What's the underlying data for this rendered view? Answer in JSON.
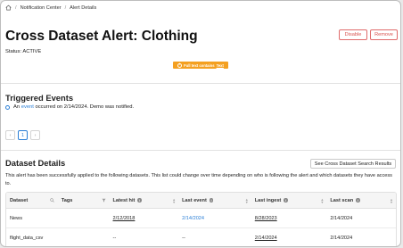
{
  "breadcrumb": {
    "items": [
      "Notification Center",
      "Alert Details"
    ]
  },
  "page": {
    "title": "Cross Dataset Alert: Clothing",
    "status": "Status: ACTIVE"
  },
  "actions": {
    "disable": "Disable",
    "remove": "Remove"
  },
  "banner": {
    "text": "Full text contains",
    "link": "Text",
    "color": "#f4a020"
  },
  "triggered": {
    "title": "Triggered Events",
    "event": {
      "prefix": "An",
      "link": "event",
      "suffix": "occurred on 2/14/2024. Demo was notified."
    }
  },
  "pagination": {
    "prev": "‹",
    "current": "1",
    "next": "›"
  },
  "datasets": {
    "title": "Dataset Details",
    "search_button": "See Cross Dataset Search Results",
    "description": "This alert has been successfully applied to the following datasets. This list could change over time depending on who is following the alert and which datasets they have access to.",
    "columns": [
      "Dataset",
      "Tags",
      "Latest hit",
      "Last event",
      "Last ingest",
      "Last scan"
    ],
    "rows": [
      {
        "dataset": "News",
        "tags": "",
        "latest_hit": "2/12/2018",
        "last_event": "2/14/2024",
        "last_ingest": "8/28/2023",
        "last_scan": "2/14/2024"
      },
      {
        "dataset": "flight_data_csv",
        "tags": "",
        "latest_hit": "--",
        "last_event": "--",
        "last_ingest": "2/14/2024",
        "last_scan": "2/14/2024"
      }
    ]
  },
  "colors": {
    "accent": "#2b7fd6",
    "danger": "#d9534f"
  }
}
